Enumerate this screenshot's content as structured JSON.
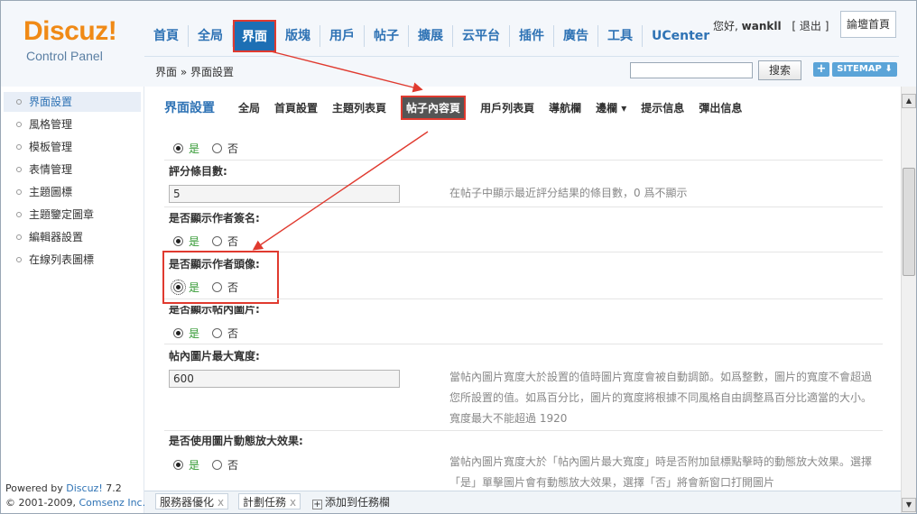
{
  "logo": {
    "word": "Discuz!",
    "sub": "Control Panel"
  },
  "top_nav": [
    "首頁",
    "全局",
    "界面",
    "版塊",
    "用戶",
    "帖子",
    "擴展",
    "云平台",
    "插件",
    "廣告",
    "工具",
    "UCenter"
  ],
  "top_nav_active": "界面",
  "welcome": {
    "prefix": "您好,",
    "user": "wankll",
    "logout": "[ 退出 ]"
  },
  "forum_home": "論壇首頁",
  "breadcrumb": "界面 » 界面設置",
  "search": {
    "button": "搜索",
    "value": ""
  },
  "sitemap": "SITEMAP",
  "plus": "+",
  "sidebar": {
    "items": [
      {
        "label": "界面設置"
      },
      {
        "label": "風格管理"
      },
      {
        "label": "模板管理"
      },
      {
        "label": "表情管理"
      },
      {
        "label": "主題圖標"
      },
      {
        "label": "主題鑒定圖章"
      },
      {
        "label": "編輯器設置"
      },
      {
        "label": "在線列表圖標"
      }
    ]
  },
  "powered": {
    "line1_prefix": "Powered by ",
    "line1_link": "Discuz!",
    "line1_suffix": " 7.2",
    "line2_prefix": "© 2001-2009, ",
    "line2_link": "Comsenz Inc."
  },
  "sub_nav": {
    "title": "界面設置",
    "items": [
      "全局",
      "首頁設置",
      "主題列表頁",
      "帖子內容頁",
      "用戶列表頁",
      "導航欄",
      "邊欄 ▾",
      "提示信息",
      "彈出信息"
    ],
    "active": "帖子內容頁"
  },
  "form": {
    "yes": "是",
    "no": "否",
    "rating_count_label": "評分條目數:",
    "rating_count_value": "5",
    "rating_count_hint": "在帖子中顯示最近評分結果的條目數，0 爲不顯示",
    "show_signature_label": "是否顯示作者簽名:",
    "show_avatar_label": "是否顯示作者頭像:",
    "show_images_label": "是否顯示帖內圖片:",
    "max_img_width_label": "帖內圖片最大寬度:",
    "max_img_width_value": "600",
    "max_img_width_hint_1": "當帖內圖片寬度大於設置的值時圖片寬度會被自動調節。如爲整數，圖片的寬度不會超過",
    "max_img_width_hint_2": "您所設置的值。如爲百分比，圖片的寬度將根據不同風格自由調整爲百分比適當的大小。",
    "max_img_width_hint_3": "寬度最大不能超過 1920",
    "zoom_effect_label": "是否使用圖片動態放大效果:",
    "zoom_effect_hint_1": "當帖內圖片寬度大於「帖內圖片最大寬度」時是否附加鼠標點擊時的動態放大效果。選擇",
    "zoom_effect_hint_2": "「是」單擊圖片會有動態放大效果，選擇「否」將會新窗口打開圖片"
  },
  "taskbar": {
    "tasks": [
      "服務器優化",
      "計劃任務"
    ],
    "close": "x",
    "add": "添加到任務欄"
  },
  "colors": {
    "accent": "#2f73b5",
    "highlight": "#e03a2f",
    "logo": "#f08a16",
    "yes_green": "#339933"
  }
}
